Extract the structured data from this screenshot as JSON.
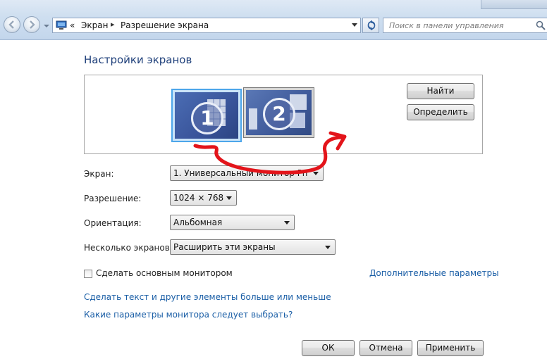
{
  "address_bar": {
    "breadcrumb_prefix": "«",
    "crumbs": [
      "Экран",
      "Разрешение экрана"
    ],
    "separator": "▸"
  },
  "search": {
    "placeholder": "Поиск в панели управления"
  },
  "heading": "Настройки экранов",
  "monitors": [
    {
      "number": "1",
      "selected": true
    },
    {
      "number": "2",
      "selected": false
    }
  ],
  "buttons": {
    "detect": "Найти",
    "identify": "Определить",
    "ok": "ОК",
    "cancel": "Отмена",
    "apply": "Применить"
  },
  "settings": {
    "display": {
      "label": "Экран:",
      "value": "1. Универсальный монитор PnP"
    },
    "resolution": {
      "label": "Разрешение:",
      "value": "1024 × 768"
    },
    "orientation": {
      "label": "Ориентация:",
      "value": "Альбомная"
    },
    "multiple": {
      "label": "Несколько экранов:",
      "value": "Расширить эти экраны"
    }
  },
  "primary_checkbox": {
    "label": "Сделать основным монитором",
    "checked": false
  },
  "links": {
    "advanced": "Дополнительные параметры",
    "text_size": "Сделать текст и другие элементы больше или меньше",
    "which_settings": "Какие параметры монитора следует выбрать?"
  },
  "colors": {
    "heading": "#1e3f7a",
    "link": "#1a5ea6",
    "selected_monitor_border": "#4da6ea",
    "annotation": "#e3141a"
  }
}
